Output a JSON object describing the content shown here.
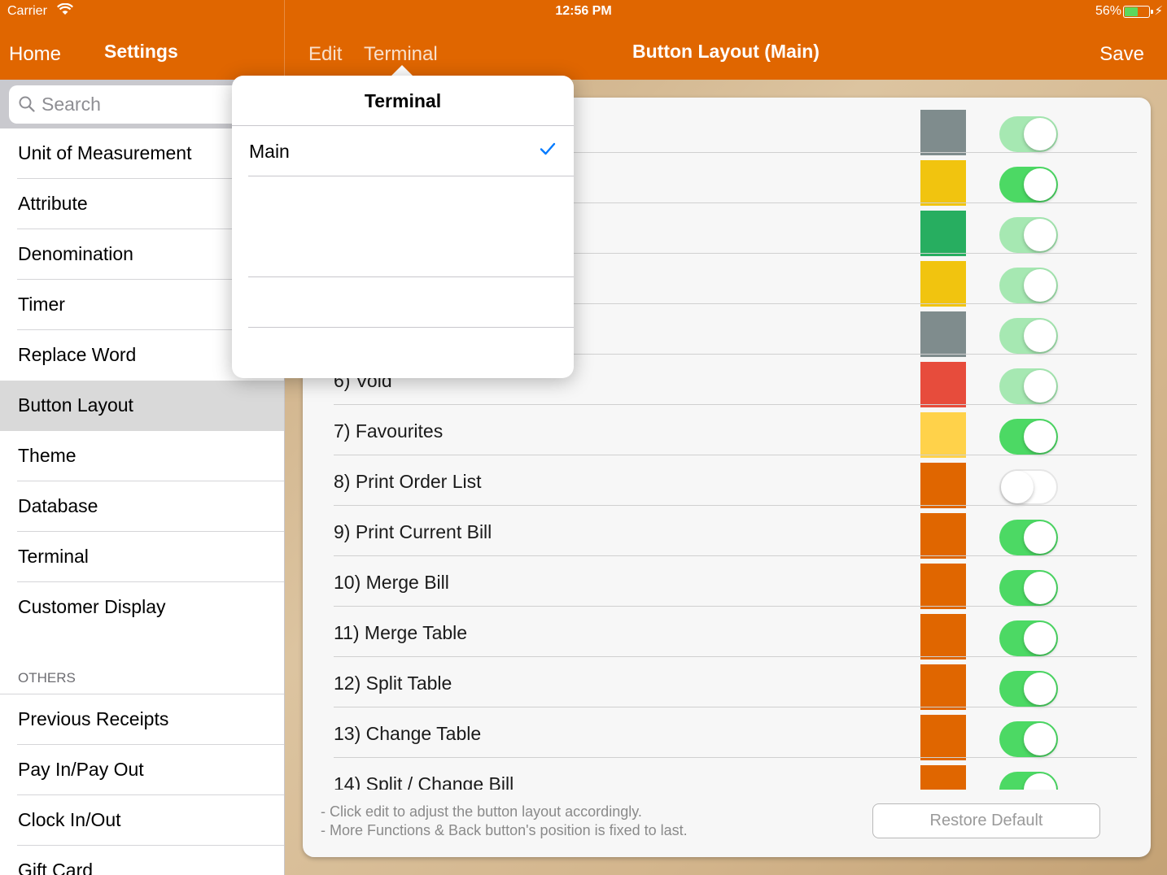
{
  "status_bar": {
    "carrier": "Carrier",
    "time": "12:56 PM",
    "battery_percent": "56%",
    "battery_level": 0.56
  },
  "nav": {
    "home": "Home",
    "settings_title": "Settings",
    "edit": "Edit",
    "terminal": "Terminal",
    "title": "Button Layout (Main)",
    "save": "Save"
  },
  "sidebar": {
    "search_placeholder": "Search",
    "items": [
      "Unit of Measurement",
      "Attribute",
      "Denomination",
      "Timer",
      "Replace Word",
      "Button Layout",
      "Theme",
      "Database",
      "Terminal",
      "Customer Display"
    ],
    "selected": "Button Layout",
    "others_header": "OTHERS",
    "others_items": [
      "Previous Receipts",
      "Pay In/Pay Out",
      "Clock In/Out",
      "Gift Card"
    ]
  },
  "buttons": [
    {
      "label": "",
      "color": "#7f8c8d",
      "toggle": "dim"
    },
    {
      "label": "",
      "color": "#f1c40f",
      "toggle": "on"
    },
    {
      "label": "",
      "color": "#27ae60",
      "toggle": "dim"
    },
    {
      "label": "",
      "color": "#f1c40f",
      "toggle": "dim"
    },
    {
      "label": "",
      "color": "#7f8c8d",
      "toggle": "dim"
    },
    {
      "label": "6) Void",
      "color": "#e74c3c",
      "toggle": "dim"
    },
    {
      "label": "7) Favourites",
      "color": "#ffd24a",
      "toggle": "on"
    },
    {
      "label": "8) Print Order List",
      "color": "#e06600",
      "toggle": "off"
    },
    {
      "label": "9) Print Current Bill",
      "color": "#e06600",
      "toggle": "on"
    },
    {
      "label": "10) Merge Bill",
      "color": "#e06600",
      "toggle": "on"
    },
    {
      "label": "11) Merge Table",
      "color": "#e06600",
      "toggle": "on"
    },
    {
      "label": "12) Split Table",
      "color": "#e06600",
      "toggle": "on"
    },
    {
      "label": "13) Change Table",
      "color": "#e06600",
      "toggle": "on"
    },
    {
      "label": "14) Split / Change Bill",
      "color": "#e06600",
      "toggle": "on"
    }
  ],
  "footer": {
    "note1": "- Click edit to adjust the button layout accordingly.",
    "note2": "- More Functions & Back button's position is fixed to last.",
    "restore_label": "Restore Default"
  },
  "popover": {
    "title": "Terminal",
    "items": [
      "Main"
    ],
    "selected": "Main",
    "empty_rows": 3
  },
  "colors": {
    "accent": "#e06600",
    "toggle_on": "#4cd964",
    "check": "#007aff"
  }
}
